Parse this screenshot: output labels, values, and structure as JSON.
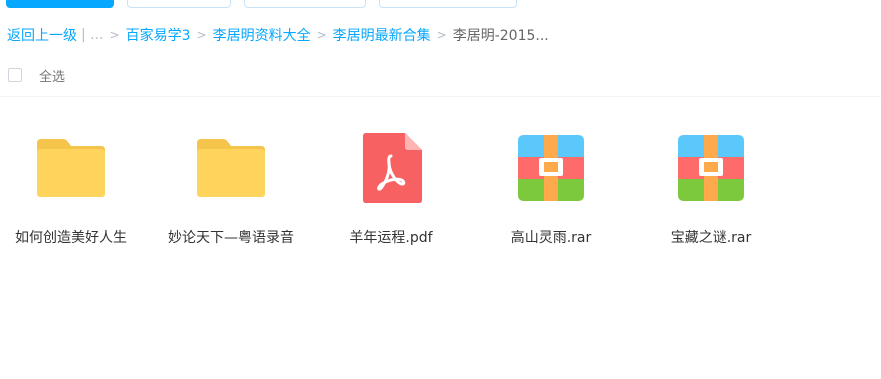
{
  "breadcrumb": {
    "back": "返回上一级",
    "ellipsis": "| ...",
    "items": [
      "百家易学3",
      "李居明资料大全",
      "李居明最新合集"
    ],
    "current": "李居明-2015..."
  },
  "select_all": {
    "label": "全选"
  },
  "files": [
    {
      "name": "如何创造美好人生",
      "type": "folder",
      "icon": "folder-icon"
    },
    {
      "name": "妙论天下—粤语录音",
      "type": "folder",
      "icon": "folder-icon"
    },
    {
      "name": "羊年运程.pdf",
      "type": "pdf",
      "icon": "pdf-icon"
    },
    {
      "name": "高山灵雨.rar",
      "type": "rar",
      "icon": "archive-icon"
    },
    {
      "name": "宝藏之谜.rar",
      "type": "rar",
      "icon": "archive-icon"
    }
  ],
  "colors": {
    "accent": "#06a7ff",
    "folder": "#ffd45c",
    "folder_tab": "#f5c44a",
    "pdf": "#f86161",
    "archive_blue": "#5ac8fa",
    "archive_red": "#ff6b6b",
    "archive_green": "#7dc93e",
    "archive_orange": "#ffa94d"
  }
}
